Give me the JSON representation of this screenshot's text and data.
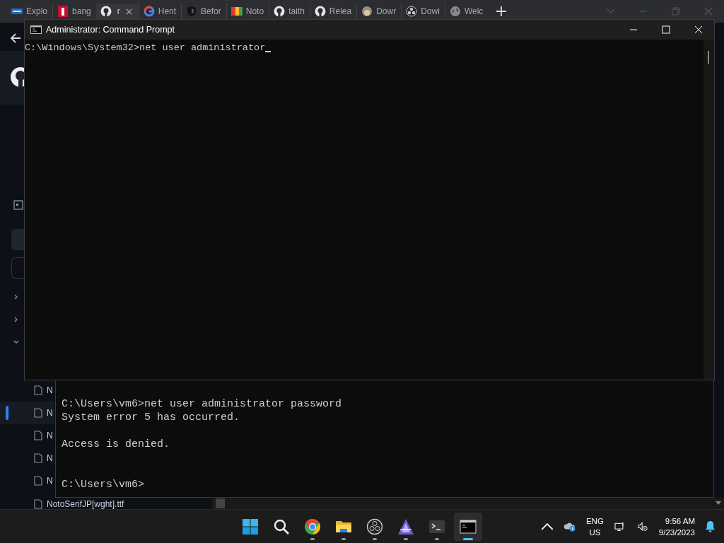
{
  "browser": {
    "tabs": [
      {
        "kind": "vm",
        "title": "Explo",
        "selected": false
      },
      {
        "kind": "red",
        "title": "bang",
        "selected": false
      },
      {
        "kind": "github",
        "title": "r",
        "selected": true
      },
      {
        "kind": "google",
        "title": "Hent",
        "selected": false
      },
      {
        "kind": "shield",
        "title": "Befor",
        "selected": false
      },
      {
        "kind": "noto",
        "title": "Noto",
        "selected": false
      },
      {
        "kind": "github",
        "title": "taith",
        "selected": false
      },
      {
        "kind": "github",
        "title": "Relea",
        "selected": false
      },
      {
        "kind": "monkey",
        "title": "Dowr",
        "selected": false
      },
      {
        "kind": "obs",
        "title": "Dowi",
        "selected": false
      },
      {
        "kind": "globe",
        "title": "Welc",
        "selected": false
      }
    ],
    "tree": [
      {
        "expanded": false
      },
      {
        "expanded": false
      },
      {
        "expanded": true
      }
    ],
    "files": [
      {
        "name": "N",
        "selected": false
      },
      {
        "name": "N",
        "selected": true
      },
      {
        "name": "N",
        "selected": false
      },
      {
        "name": "N",
        "selected": false
      },
      {
        "name": "N",
        "selected": false
      },
      {
        "name": "NotoSerifJP[wght].ttf",
        "selected": false
      }
    ]
  },
  "cmd_window": {
    "title": "Administrator: Command Prompt",
    "lines": [
      "C:\\Windows\\System32>net user administrator"
    ]
  },
  "back_terminal": {
    "blocks": [
      {
        "kind": "output",
        "lines": [
          "C:\\Users\\vm6>net user administrator password",
          "System error 5 has occurred."
        ]
      },
      {
        "kind": "output",
        "lines": [
          "Access is denied."
        ]
      },
      {
        "kind": "prompt",
        "lines": [
          "C:\\Users\\vm6>"
        ]
      }
    ]
  },
  "taskbar": {
    "apps": [
      {
        "kind": "start",
        "running": false,
        "active": false
      },
      {
        "kind": "search",
        "running": false,
        "active": false
      },
      {
        "kind": "chrome",
        "running": true,
        "active": false
      },
      {
        "kind": "folder",
        "running": true,
        "active": false
      },
      {
        "kind": "obs",
        "running": true,
        "active": false
      },
      {
        "kind": "triangle",
        "running": true,
        "active": false
      },
      {
        "kind": "terminal",
        "running": true,
        "active": false
      },
      {
        "kind": "cmd",
        "running": true,
        "active": true
      }
    ],
    "tray": {
      "language": "ENG",
      "region": "US",
      "time": "9:56 AM",
      "date": "9/23/2023"
    }
  }
}
